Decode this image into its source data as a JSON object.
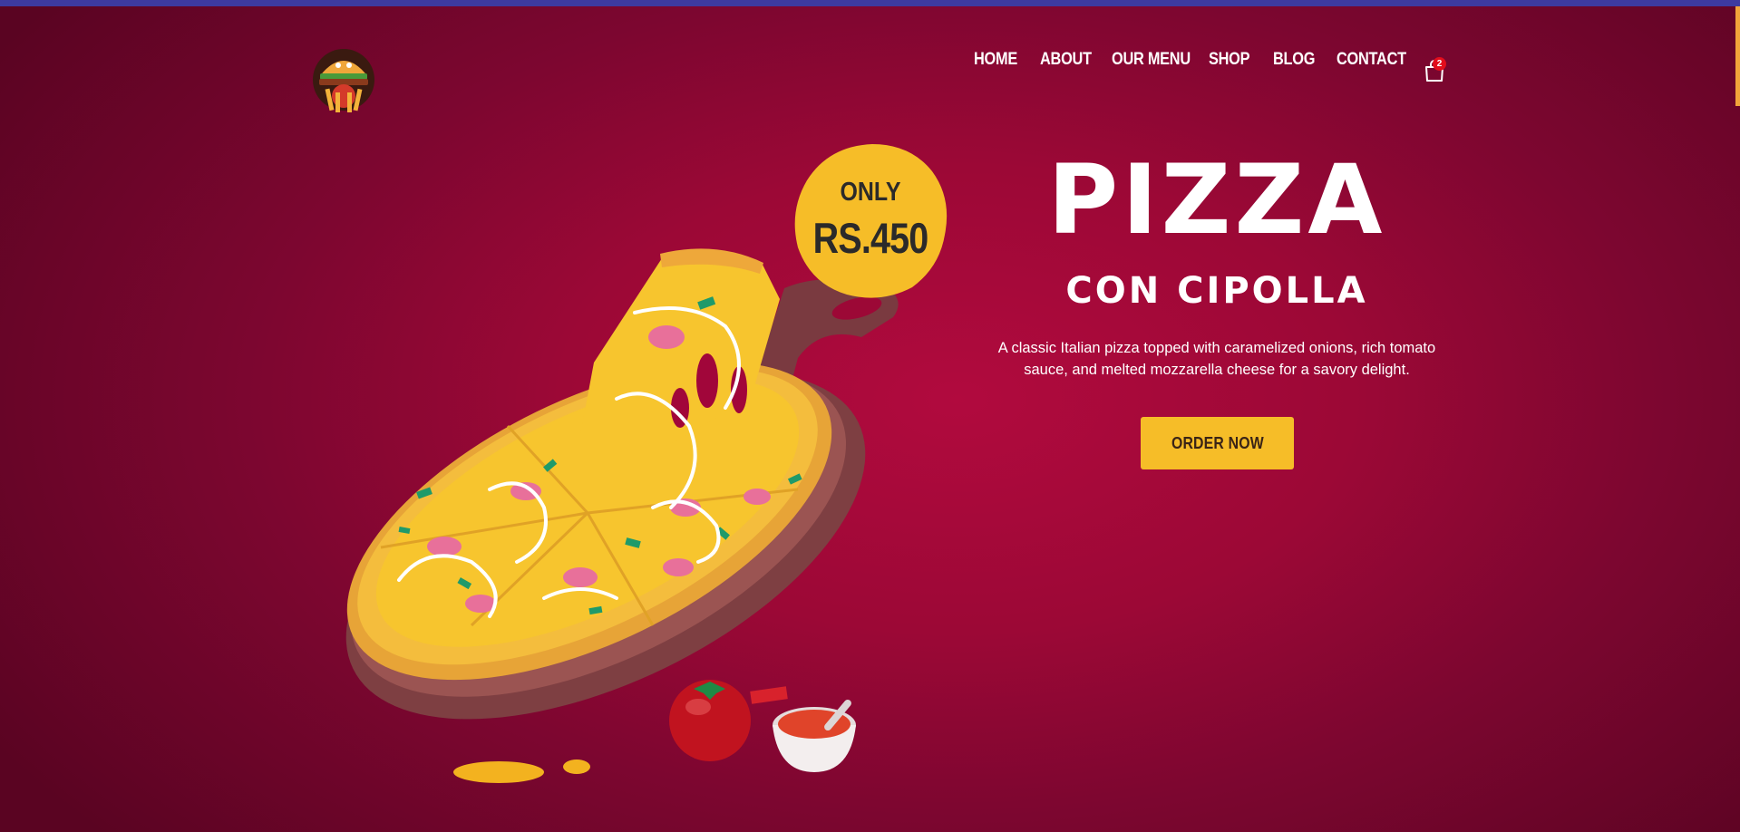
{
  "brand": {
    "logo_icon": "burger-fries-mascot-icon"
  },
  "nav": {
    "items": [
      {
        "label": "HOME"
      },
      {
        "label": "ABOUT"
      },
      {
        "label": "OUR MENU"
      },
      {
        "label": "SHOP"
      },
      {
        "label": "BLOG"
      },
      {
        "label": "CONTACT"
      }
    ],
    "cart_icon": "shopping-bag-icon",
    "cart_count": "2"
  },
  "price_badge": {
    "line1": "ONLY",
    "price": "RS.450"
  },
  "hero": {
    "title": "PIZZA",
    "subtitle": "CON CIPOLLA",
    "description": "A classic Italian pizza topped with caramelized onions, rich tomato sauce, and melted mozzarella cheese for a savory delight.",
    "cta_label": "ORDER NOW"
  },
  "colors": {
    "background": "#9c0836",
    "accent": "#f6bd28",
    "text": "#ffffff",
    "badge_text": "#2b2a2a",
    "cart_badge": "#e20d1c"
  }
}
